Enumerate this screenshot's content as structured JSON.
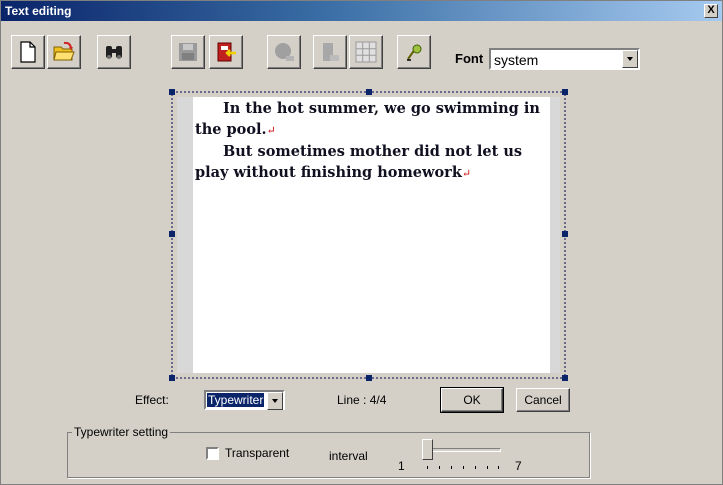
{
  "window": {
    "title": "Text editing",
    "close_glyph": "X"
  },
  "toolbar": {
    "buttons": [
      {
        "name": "new-file-icon"
      },
      {
        "name": "open-folder-icon"
      },
      {
        "name": "find-binoculars-icon"
      },
      {
        "name": "save-disabled-icon"
      },
      {
        "name": "import-icon"
      },
      {
        "name": "shape-disabled-icon"
      },
      {
        "name": "image-disabled-icon"
      },
      {
        "name": "table-grid-icon"
      },
      {
        "name": "clear-format-icon"
      }
    ],
    "font_label": "Font",
    "font_value": "system"
  },
  "editor": {
    "lines": [
      "In the hot summer, we go swimming in",
      "the pool.",
      "But sometimes mother did not let us",
      "play without finishing homework"
    ],
    "return_mark": "↵"
  },
  "effect": {
    "label": "Effect:",
    "value": "Typewriter"
  },
  "line_status": "Line : 4/4",
  "buttons": {
    "ok": "OK",
    "cancel": "Cancel"
  },
  "typewriter_setting": {
    "legend": "Typewriter setting",
    "transparent_label": "Transparent",
    "transparent_checked": false,
    "interval_label": "interval",
    "interval_min": "1",
    "interval_max": "7",
    "interval_value": 1
  }
}
